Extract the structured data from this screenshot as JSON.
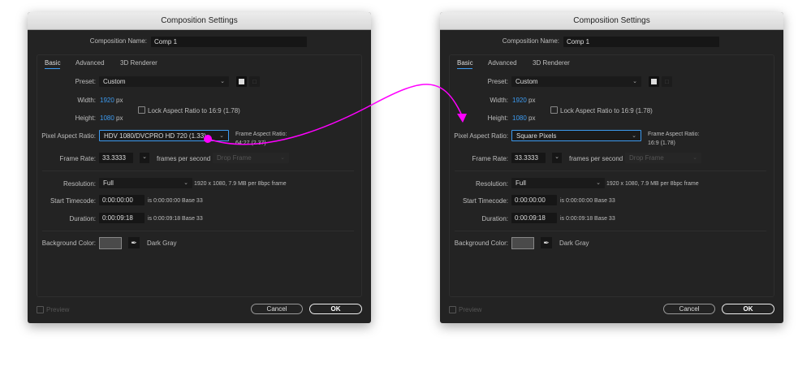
{
  "dialogs": [
    {
      "title": "Composition Settings",
      "name_label": "Composition Name:",
      "name_value": "Comp 1",
      "tabs": [
        "Basic",
        "Advanced",
        "3D Renderer"
      ],
      "preset_label": "Preset:",
      "preset_value": "Custom",
      "width_label": "Width:",
      "width_value": "1920",
      "px": "px",
      "height_label": "Height:",
      "height_value": "1080",
      "lock_label": "Lock Aspect Ratio to 16:9 (1.78)",
      "par_label": "Pixel Aspect Ratio:",
      "par_value": "HDV 1080/DVCPRO HD 720 (1.33)",
      "far_label": "Frame Aspect Ratio:",
      "far_value": "64:27 (2.37)",
      "fr_label": "Frame Rate:",
      "fr_value": "33.3333",
      "fps": "frames per second",
      "drop_frame": "Drop Frame",
      "res_label": "Resolution:",
      "res_value": "Full",
      "res_info": "1920 x 1080, 7.9 MB per 8bpc frame",
      "stc_label": "Start Timecode:",
      "stc_value": "0:00:00:00",
      "stc_info": "is 0:00:00:00  Base 33",
      "dur_label": "Duration:",
      "dur_value": "0:00:09:18",
      "dur_info": "is 0:00:09:18  Base 33",
      "bg_label": "Background Color:",
      "bg_name": "Dark Gray",
      "preview": "Preview",
      "cancel": "Cancel",
      "ok": "OK"
    },
    {
      "title": "Composition Settings",
      "name_label": "Composition Name:",
      "name_value": "Comp 1",
      "tabs": [
        "Basic",
        "Advanced",
        "3D Renderer"
      ],
      "preset_label": "Preset:",
      "preset_value": "Custom",
      "width_label": "Width:",
      "width_value": "1920",
      "px": "px",
      "height_label": "Height:",
      "height_value": "1080",
      "lock_label": "Lock Aspect Ratio to 16:9 (1.78)",
      "par_label": "Pixel Aspect Ratio:",
      "par_value": "Square Pixels",
      "far_label": "Frame Aspect Ratio:",
      "far_value": "16:9 (1.78)",
      "fr_label": "Frame Rate:",
      "fr_value": "33.3333",
      "fps": "frames per second",
      "drop_frame": "Drop Frame",
      "res_label": "Resolution:",
      "res_value": "Full",
      "res_info": "1920 x 1080, 7.9 MB per 8bpc frame",
      "stc_label": "Start Timecode:",
      "stc_value": "0:00:00:00",
      "stc_info": "is 0:00:00:00  Base 33",
      "dur_label": "Duration:",
      "dur_value": "0:00:09:18",
      "dur_info": "is 0:00:09:18  Base 33",
      "bg_label": "Background Color:",
      "bg_name": "Dark Gray",
      "preview": "Preview",
      "cancel": "Cancel",
      "ok": "OK"
    }
  ],
  "colors": {
    "accent": "#3d9bf0",
    "annotation": "#ff00ff",
    "bg_swatch": "#4a4a4a"
  }
}
